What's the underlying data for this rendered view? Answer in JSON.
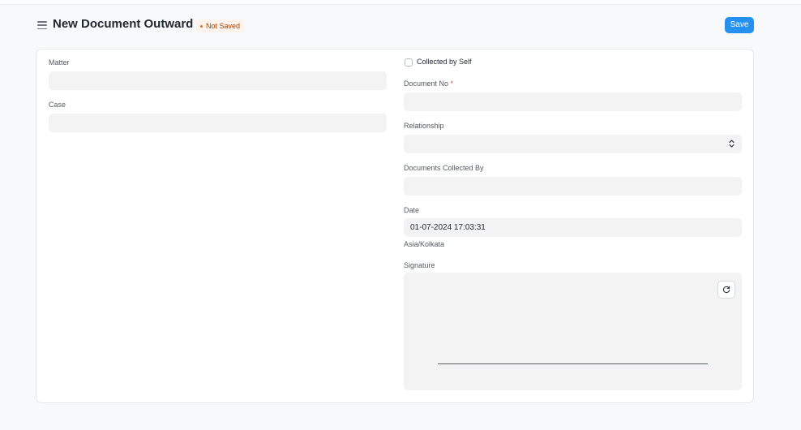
{
  "header": {
    "title": "New Document Outward",
    "status": "Not Saved",
    "save_label": "Save"
  },
  "form": {
    "matter": {
      "label": "Matter",
      "value": ""
    },
    "case": {
      "label": "Case",
      "value": ""
    },
    "collected_by_self": {
      "label": "Collected by Self",
      "checked": false
    },
    "document_no": {
      "label": "Document No",
      "required_mark": "*",
      "value": ""
    },
    "relationship": {
      "label": "Relationship",
      "value": ""
    },
    "documents_collected_by": {
      "label": "Documents Collected By",
      "value": ""
    },
    "date": {
      "label": "Date",
      "value": "01-07-2024 17:03:31",
      "timezone": "Asia/Kolkata"
    },
    "signature": {
      "label": "Signature"
    }
  },
  "icons": {
    "menu": "hamburger-icon",
    "select_caret": "chevron-up-down-icon",
    "reset": "refresh-icon"
  },
  "colors": {
    "primary": "#2490ef",
    "status_badge_bg": "#fff4ec",
    "status_badge_text": "#a43e00",
    "required": "#e24c4c",
    "field_bg": "#f3f3f4"
  }
}
